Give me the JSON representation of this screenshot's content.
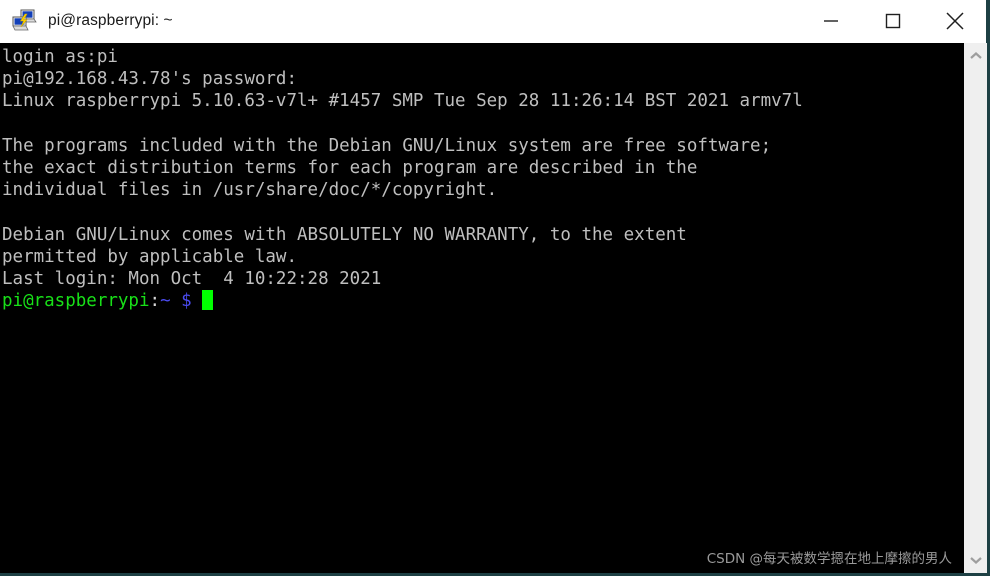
{
  "window": {
    "title": "pi@raspberrypi: ~",
    "icon": "putty-computers-icon",
    "border_color": "#1d4044",
    "titlebar_bg": "#ffffff",
    "controls": {
      "minimize_label": "Minimize",
      "maximize_label": "Maximize",
      "close_label": "Close"
    }
  },
  "terminal": {
    "background": "#000000",
    "foreground": "#bfbfbf",
    "prompt_user_color": "#18e018",
    "prompt_path_color": "#4b4bf0",
    "cursor_color": "#00ff00",
    "lines": [
      "login as:pi",
      "pi@192.168.43.78's password:",
      "Linux raspberrypi 5.10.63-v7l+ #1457 SMP Tue Sep 28 11:26:14 BST 2021 armv7l",
      "",
      "The programs included with the Debian GNU/Linux system are free software;",
      "the exact distribution terms for each program are described in the",
      "individual files in /usr/share/doc/*/copyright.",
      "",
      "Debian GNU/Linux comes with ABSOLUTELY NO WARRANTY, to the extent",
      "permitted by applicable law.",
      "Last login: Mon Oct  4 10:22:28 2021"
    ],
    "prompt": {
      "user_host": "pi@raspberrypi",
      "separator": ":",
      "path": "~",
      "symbol": "$",
      "cursor": "block"
    }
  },
  "scrollbar": {
    "up_arrow": "chevron-up-icon",
    "down_arrow": "chevron-down-icon",
    "track_color": "#efefef"
  },
  "watermark": {
    "text": "CSDN @每天被数学摁在地上摩擦的男人"
  }
}
